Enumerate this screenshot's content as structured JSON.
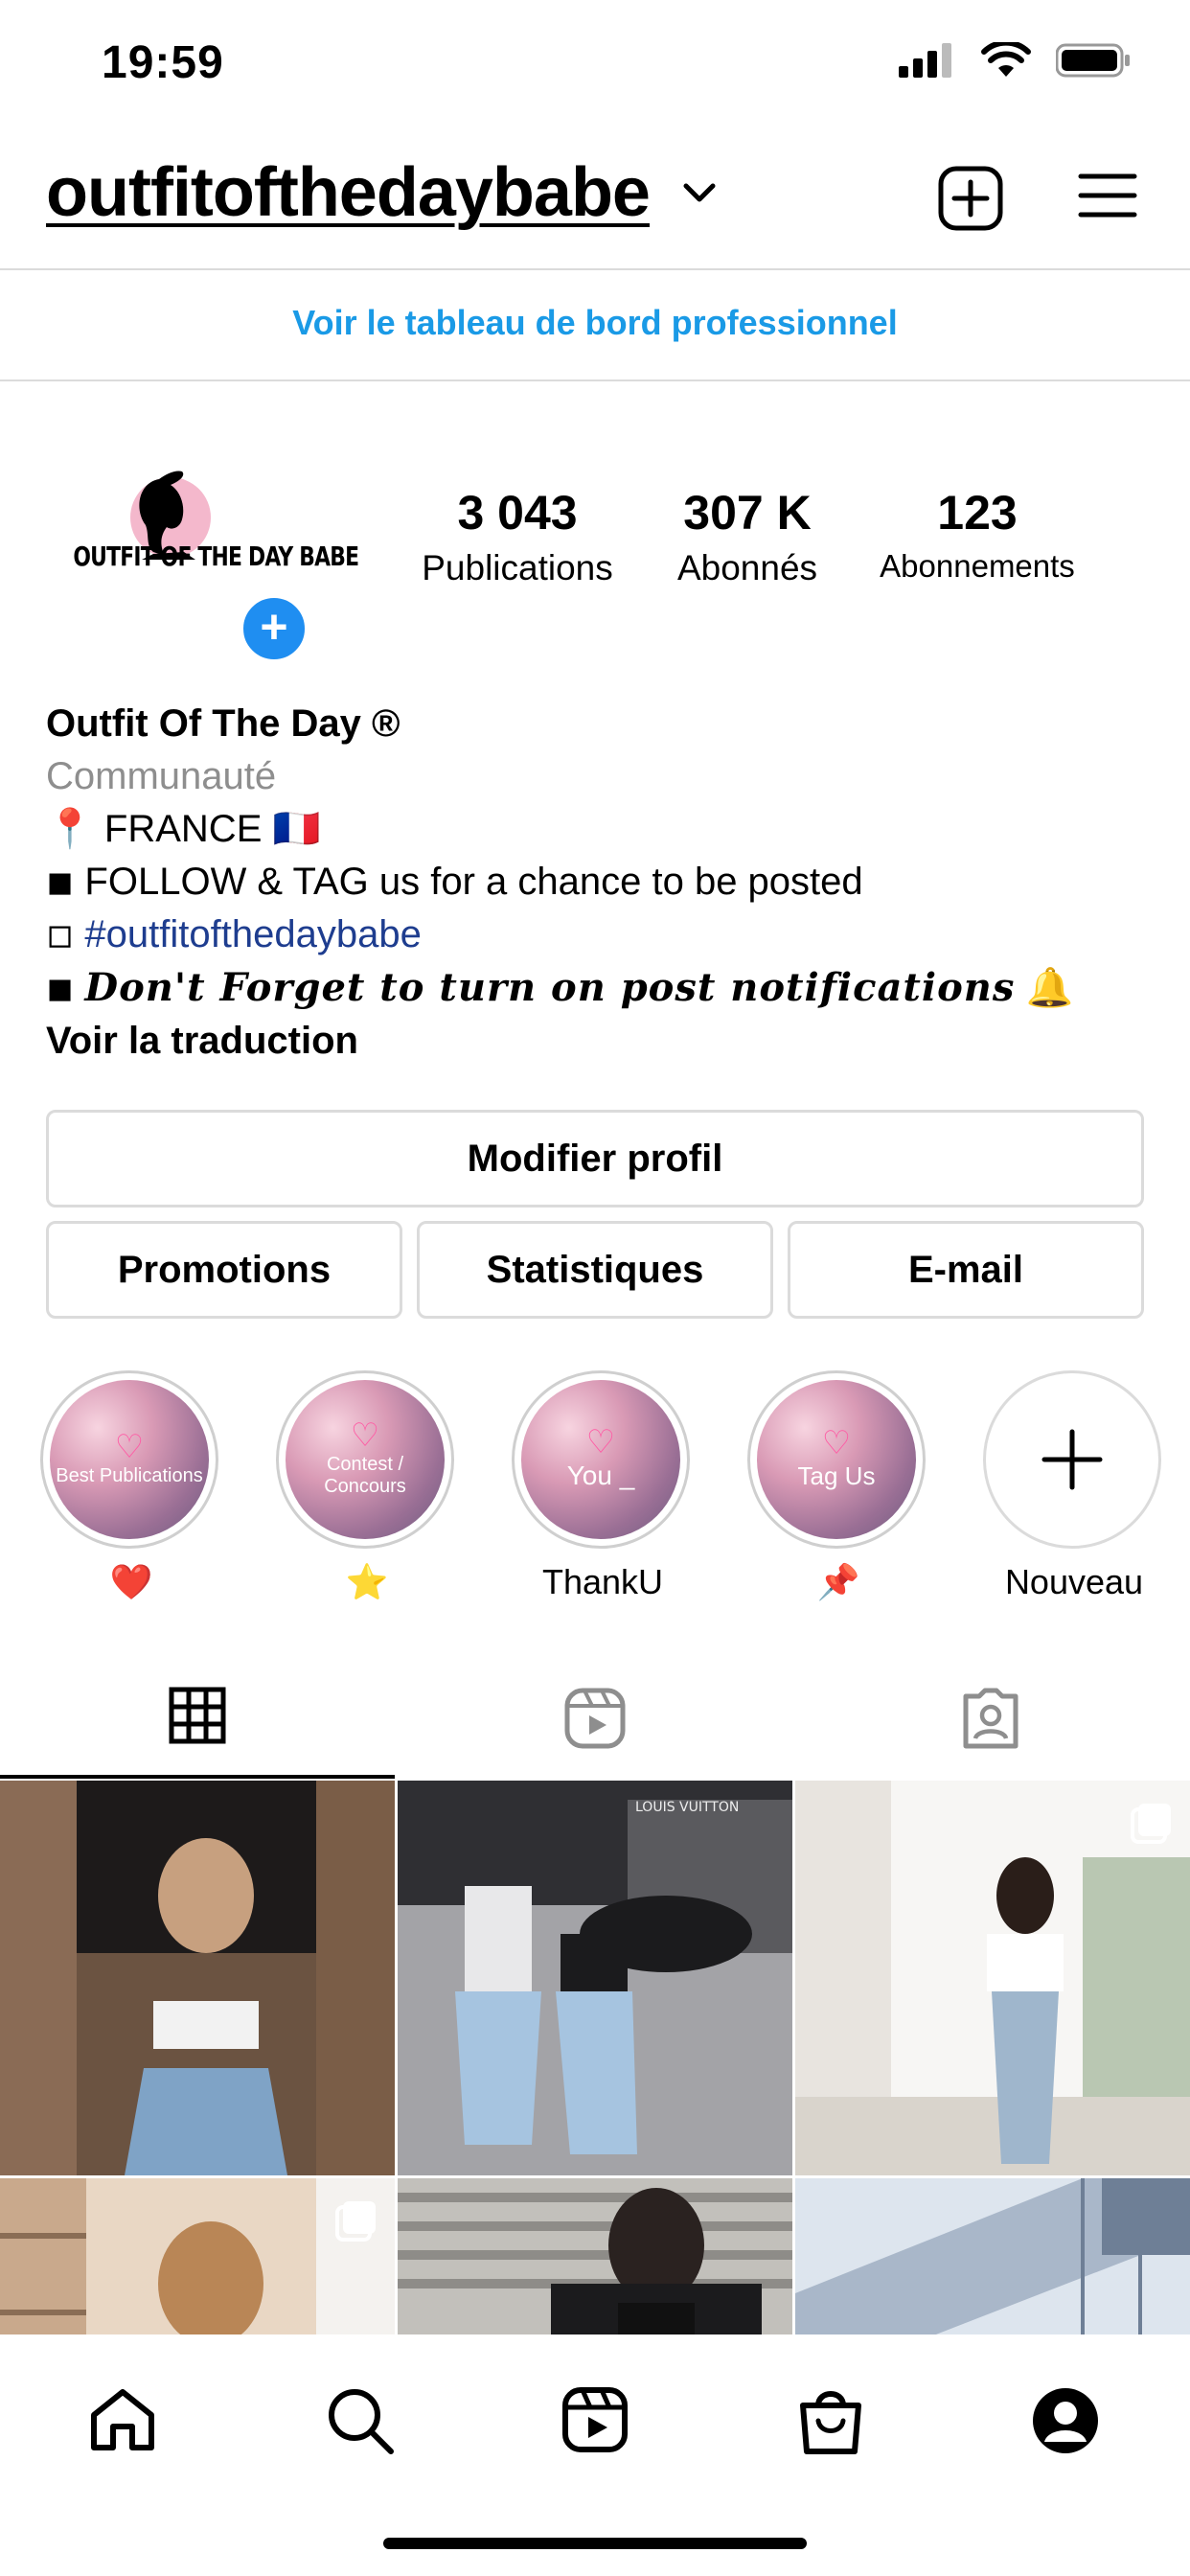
{
  "status_bar": {
    "time": "19:59"
  },
  "header": {
    "username": "outfitofthedaybabe"
  },
  "professional_dashboard": "Voir le tableau de bord professionnel",
  "profile": {
    "avatar_text": "OUTFIT OF THE DAY BABE",
    "stats": [
      {
        "value": "3 043",
        "label": "Publications"
      },
      {
        "value": "307 K",
        "label": "Abonnés"
      },
      {
        "value": "123",
        "label": "Abonnements"
      }
    ],
    "bio": {
      "name": "Outfit Of The Day ®",
      "category": "Communauté",
      "line1": "📍 FRANCE 🇫🇷",
      "line2": "◾ FOLLOW & TAG us for a chance to be posted",
      "line3_prefix": "◽ ",
      "line3_tag": "#outfitofthedaybabe",
      "line4_prefix": "◾ ",
      "line4_text": "Don't Forget to turn on post notifications",
      "line4_suffix": " 🔔",
      "see_translation": "Voir la traduction"
    }
  },
  "buttons": {
    "edit_profile": "Modifier profil",
    "promotions": "Promotions",
    "insights": "Statistiques",
    "email": "E-mail"
  },
  "highlights": [
    {
      "cover_text": "Best Publications",
      "label": "❤️"
    },
    {
      "cover_text": "Contest / Concours",
      "label": "⭐"
    },
    {
      "cover_text": "You _",
      "label": "ThankU"
    },
    {
      "cover_text": "Tag Us",
      "label": "📌"
    },
    {
      "cover_text": "",
      "label": "Nouveau"
    }
  ],
  "grid_posts": [
    {
      "multi": false,
      "colors": [
        "#6b5341",
        "#cfb6a4",
        "#7fa3c6"
      ]
    },
    {
      "multi": false,
      "colors": [
        "#2f2f33",
        "#a3a3a7",
        "#a6c4e0"
      ],
      "sign_text": "LOUIS VUITTON"
    },
    {
      "multi": true,
      "colors": [
        "#e8e4df",
        "#f7f6f4",
        "#9fb6cc"
      ]
    },
    {
      "multi": true,
      "colors": [
        "#c9a98c",
        "#e9d7c4",
        "#5a4535"
      ]
    },
    {
      "multi": false,
      "colors": [
        "#8e8c88",
        "#c2c0bb",
        "#1b1b1d"
      ]
    },
    {
      "multi": false,
      "colors": [
        "#a9b7c9",
        "#dde5ee",
        "#6e7f96"
      ]
    }
  ],
  "colors": {
    "link_blue": "#1a9ae6",
    "tag_navy": "#1e3d8f",
    "avatar_plus": "#1f8ef1"
  }
}
